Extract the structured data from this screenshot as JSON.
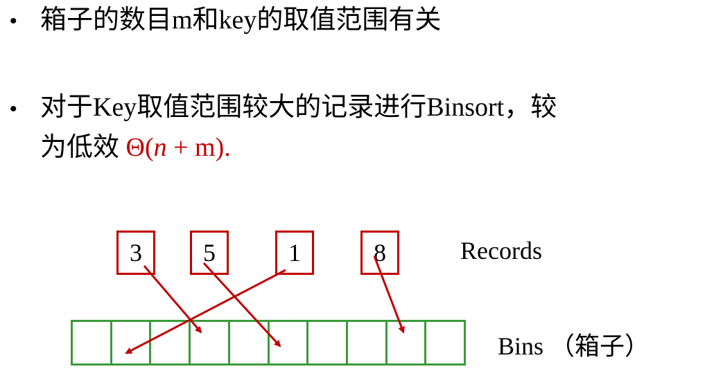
{
  "bullet_symbol": "•",
  "bullets": [
    {
      "text": "箱子的数目m和key的取值范围有关"
    },
    {
      "line1": "对于Key取值范围较大的记录进行Binsort，较",
      "line2_prefix": "为低效 ",
      "formula_theta": "Θ(",
      "formula_n": "n",
      "formula_rest": " + m).",
      "formula_color": "#c00000"
    }
  ],
  "diagram": {
    "records": [
      "3",
      "5",
      "1",
      "8"
    ],
    "records_label": "Records",
    "bins_label": "Bins （箱子）",
    "bin_count": 10,
    "record_color": "#c00000",
    "bin_color": "#3a9a3a",
    "arrow_color": "#c00000"
  }
}
